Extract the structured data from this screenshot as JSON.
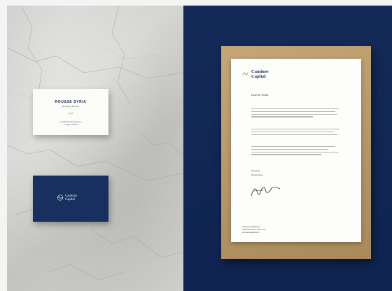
{
  "business_card_front": {
    "name": "ROUSSE SYRIA",
    "role": "Managing Director",
    "contact_line1": "hello@caminoscapital.com",
    "contact_line2": "+1 (555) 234 5678"
  },
  "business_card_back": {
    "brand_line1": "Caminos",
    "brand_line2": "Capital"
  },
  "letter": {
    "brand_line1": "Caminos",
    "brand_line2": "Capital",
    "greeting": "Dear Mr. Smith,",
    "closing": "Sincerely,",
    "signer": "Rouse Syria",
    "address_line1": "Caminos Capital Inc.",
    "address_line2": "1234 Street Ave. New York",
    "address_line3": "caminoscapital.com"
  },
  "colors": {
    "navy": "#142a58",
    "gold": "#c9a44a",
    "kraft": "#b89767",
    "paper": "#fdfdfb"
  },
  "icons": {
    "brand_mark": "caminos-wave-mark",
    "signature": "handwritten-signature"
  }
}
